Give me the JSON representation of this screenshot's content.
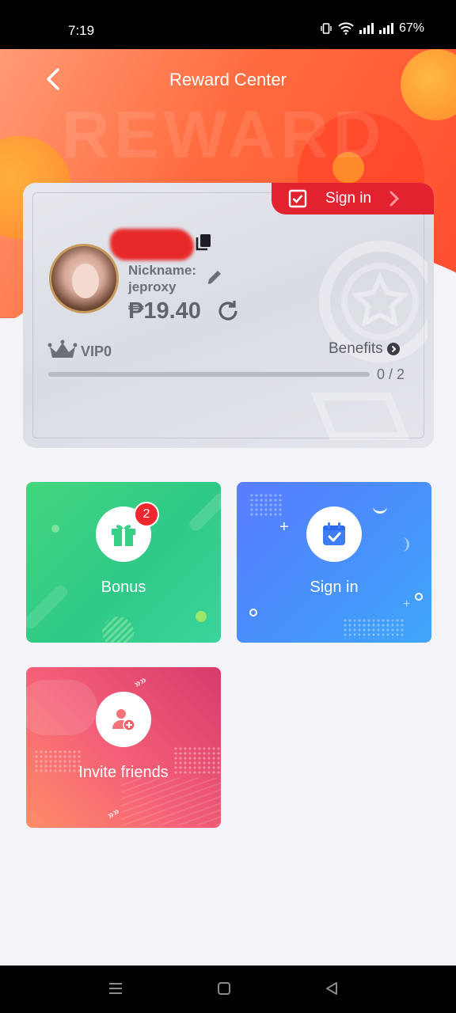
{
  "status_bar": {
    "time": "7:19",
    "battery": "67%"
  },
  "header": {
    "title": "Reward Center",
    "watermark": "REWARD"
  },
  "card": {
    "sign_in_tab": "Sign in",
    "nickname_label": "Nickname:",
    "nickname": "jeproxy",
    "balance": "₱19.40",
    "vip_level": "VIP0",
    "benefits_label": "Benefits",
    "progress": {
      "text": "0 / 2",
      "current": 0,
      "total": 2
    }
  },
  "tiles": {
    "bonus": {
      "label": "Bonus",
      "badge": "2"
    },
    "sign_in": {
      "label": "Sign in"
    },
    "invite": {
      "label": "Invite friends"
    }
  },
  "colors": {
    "accent_red": "#e3222f",
    "bonus_green": "#2fc987",
    "signin_blue": "#4a8dfc",
    "invite_pink": "#f46077"
  },
  "icons": [
    "back-icon",
    "checkbox-icon",
    "chevron-right-icon",
    "copy-icon",
    "edit-icon",
    "refresh-icon",
    "crown-icon",
    "gift-icon",
    "calendar-check-icon",
    "add-user-icon"
  ]
}
